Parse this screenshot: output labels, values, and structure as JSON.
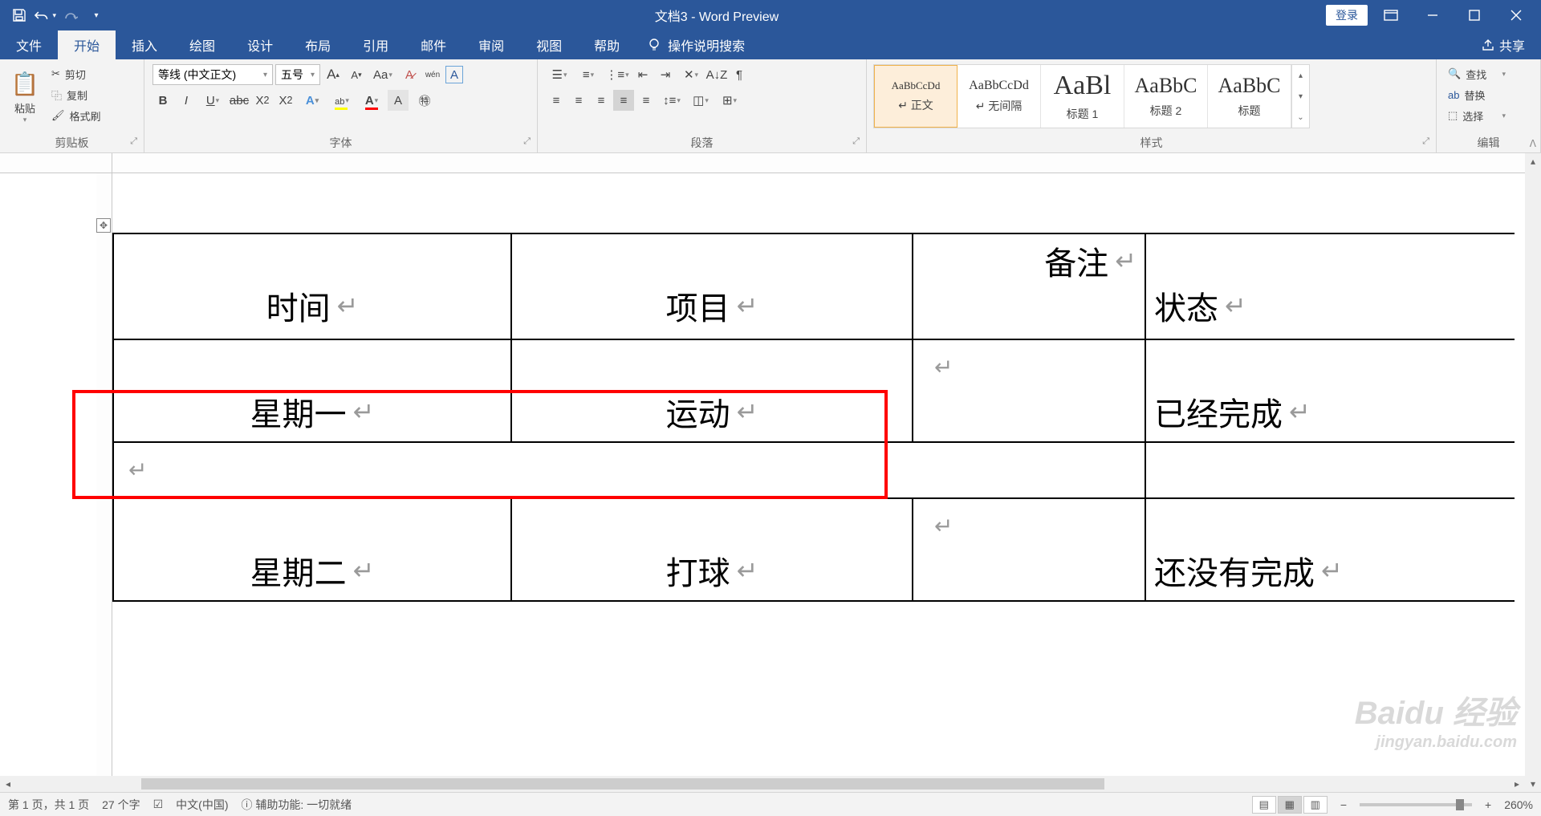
{
  "title": "文档3  -  Word Preview",
  "titlebar": {
    "login": "登录"
  },
  "tabs": {
    "file": "文件",
    "home": "开始",
    "insert": "插入",
    "draw": "绘图",
    "design": "设计",
    "layout": "布局",
    "references": "引用",
    "mailings": "邮件",
    "review": "审阅",
    "view": "视图",
    "help": "帮助",
    "tellme": "操作说明搜索",
    "share": "共享"
  },
  "ribbon": {
    "clipboard": {
      "label": "剪贴板",
      "paste": "粘贴",
      "cut": "剪切",
      "copy": "复制",
      "format_painter": "格式刷"
    },
    "font": {
      "label": "字体",
      "name": "等线 (中文正文)",
      "size": "五号"
    },
    "paragraph": {
      "label": "段落"
    },
    "styles": {
      "label": "样式",
      "items": [
        {
          "preview": "AaBbCcDd",
          "name": "↵ 正文",
          "size": "16px"
        },
        {
          "preview": "AaBbCcDd",
          "name": "↵ 无间隔",
          "size": "16px"
        },
        {
          "preview": "AaBl",
          "name": "标题 1",
          "size": "34px"
        },
        {
          "preview": "AaBbC",
          "name": "标题 2",
          "size": "26px"
        },
        {
          "preview": "AaBbC",
          "name": "标题",
          "size": "26px"
        }
      ]
    },
    "editing": {
      "label": "编辑",
      "find": "查找",
      "replace": "替换",
      "select": "选择"
    }
  },
  "document": {
    "table": {
      "row1": {
        "c1": "时间",
        "c2": "项目",
        "c3_top": "备注",
        "c4": "状态"
      },
      "row3": {
        "c1": "星期一",
        "c2": "运动",
        "c4": "已经完成"
      },
      "row5": {
        "c1": "星期二",
        "c2": "打球",
        "c4": "还没有完成"
      }
    }
  },
  "statusbar": {
    "page": "第 1 页，共 1 页",
    "words": "27 个字",
    "language": "中文(中国)",
    "accessibility": "辅助功能: 一切就绪",
    "zoom": "260%"
  },
  "watermark": {
    "main": "Baidu 经验",
    "sub": "jingyan.baidu.com"
  }
}
